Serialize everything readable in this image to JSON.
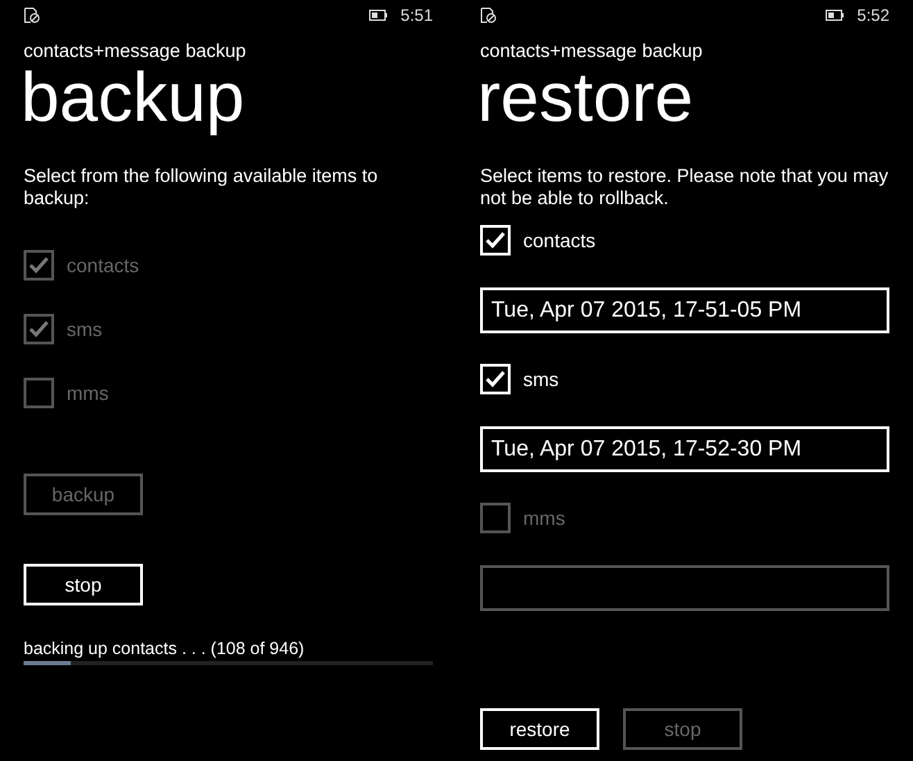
{
  "screens": [
    {
      "status_bar": {
        "time": "5:51"
      },
      "app_title": "contacts+message backup",
      "page_title": "backup",
      "description": "Select from the following available items to backup:",
      "items": [
        {
          "kind": "checkbox",
          "label": "contacts",
          "checked": true,
          "disabled": true
        },
        {
          "kind": "checkbox",
          "label": "sms",
          "checked": true,
          "disabled": true
        },
        {
          "kind": "checkbox",
          "label": "mms",
          "checked": false,
          "disabled": true
        }
      ],
      "buttons": [
        {
          "label": "backup",
          "disabled": true
        },
        {
          "label": "stop",
          "disabled": false
        }
      ],
      "progress": {
        "text": "backing up contacts . . . (108 of 946)",
        "level": 0.114
      }
    },
    {
      "status_bar": {
        "time": "5:52"
      },
      "app_title": "contacts+message backup",
      "page_title": "restore",
      "description": "Select items to restore. Please note that you may not be able to rollback.",
      "items": [
        {
          "kind": "checkbox",
          "label": "contacts",
          "checked": true,
          "disabled": false
        },
        {
          "kind": "field",
          "value": "Tue, Apr 07 2015, 17-51-05 PM",
          "disabled": false
        },
        {
          "kind": "checkbox",
          "label": "sms",
          "checked": true,
          "disabled": false
        },
        {
          "kind": "field",
          "value": "Tue, Apr 07 2015, 17-52-30 PM",
          "disabled": false
        },
        {
          "kind": "checkbox",
          "label": "mms",
          "checked": false,
          "disabled": true
        },
        {
          "kind": "field",
          "disabled": true
        }
      ],
      "buttons": [
        {
          "label": "restore",
          "disabled": false
        },
        {
          "label": "stop",
          "disabled": true
        }
      ]
    }
  ]
}
